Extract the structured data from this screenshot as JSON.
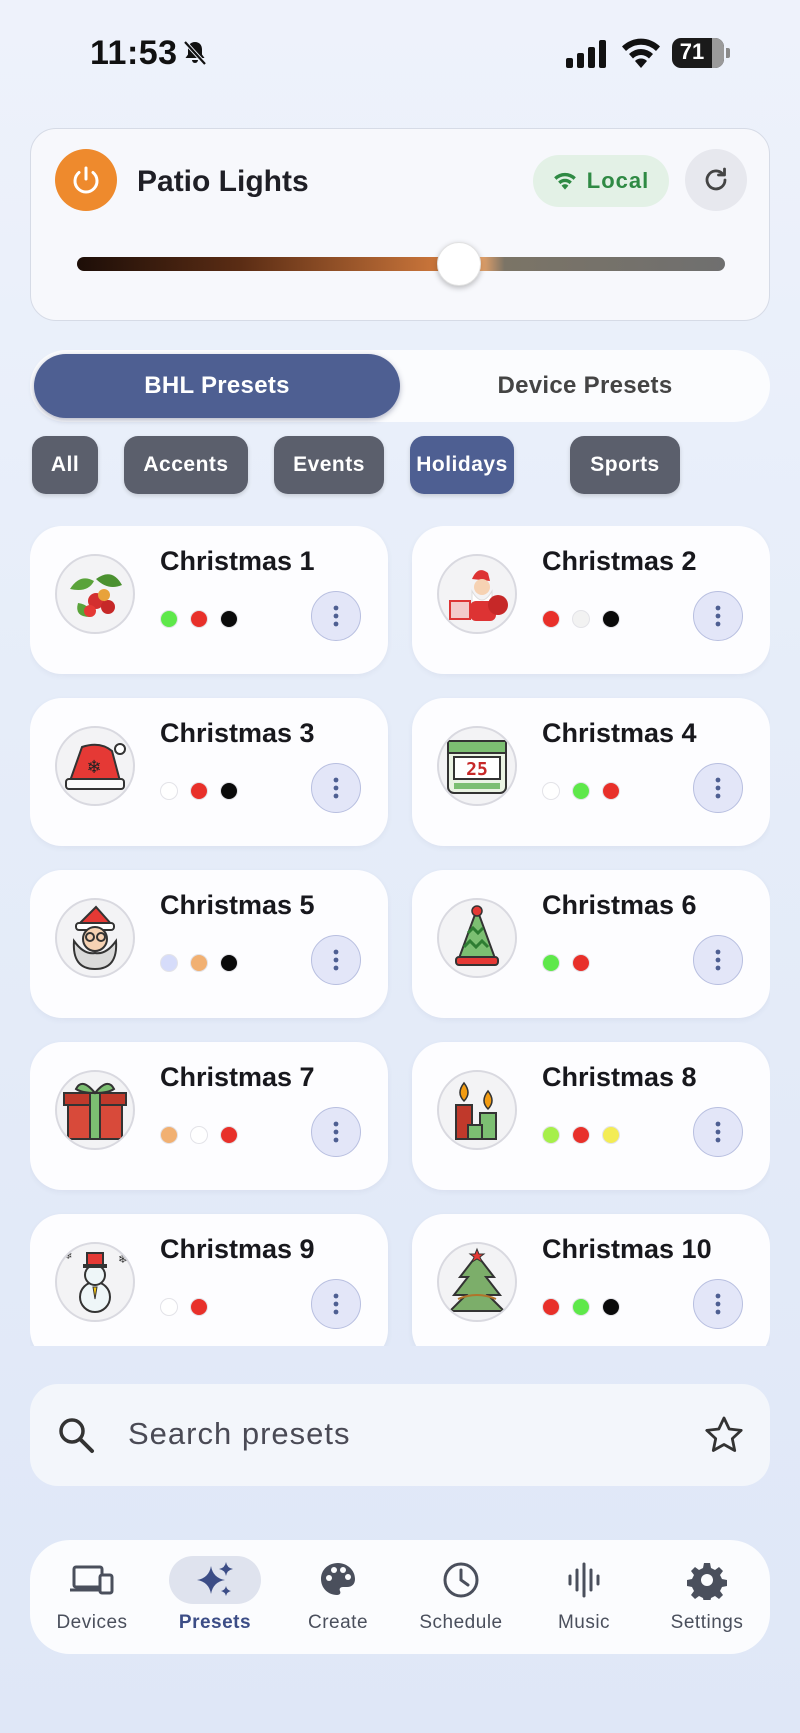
{
  "status_bar": {
    "time": "11:53",
    "battery": "71"
  },
  "device": {
    "name": "Patio Lights",
    "connection": "Local",
    "brightness_fraction": 0.59,
    "colors": {
      "power": "#ee8a2d",
      "local_text": "#2f8a44"
    }
  },
  "tabs": {
    "active": "BHL Presets",
    "inactive": "Device Presets"
  },
  "categories": [
    {
      "label": "All",
      "active": false
    },
    {
      "label": "Accents",
      "active": false
    },
    {
      "label": "Events",
      "active": false
    },
    {
      "label": "Holidays",
      "active": true
    },
    {
      "label": "Sports",
      "active": false
    }
  ],
  "presets": [
    {
      "title": "Christmas 1",
      "icon": "holly-icon",
      "colors": [
        "#5ee84a",
        "#e8302a",
        "#0a0a0a"
      ]
    },
    {
      "title": "Christmas 2",
      "icon": "santa-icon",
      "colors": [
        "#e8302a",
        "#f2f2f2",
        "#0a0a0a"
      ]
    },
    {
      "title": "Christmas 3",
      "icon": "santa-hat-icon",
      "colors": [
        "#ffffff",
        "#e8302a",
        "#0a0a0a"
      ]
    },
    {
      "title": "Christmas 4",
      "icon": "calendar-25-icon",
      "colors": [
        "#ffffff",
        "#5ee84a",
        "#e8302a"
      ]
    },
    {
      "title": "Christmas 5",
      "icon": "santa-face-icon",
      "colors": [
        "#d6dcfa",
        "#f1b072",
        "#0a0a0a"
      ]
    },
    {
      "title": "Christmas 6",
      "icon": "party-hat-icon",
      "colors": [
        "#5ee84a",
        "#e8302a"
      ]
    },
    {
      "title": "Christmas 7",
      "icon": "gift-icon",
      "colors": [
        "#f1b072",
        "#ffffff",
        "#e8302a"
      ]
    },
    {
      "title": "Christmas 8",
      "icon": "candles-icon",
      "colors": [
        "#a6ef4a",
        "#e8302a",
        "#f3ec55"
      ]
    },
    {
      "title": "Christmas 9",
      "icon": "snowman-icon",
      "colors": [
        "#ffffff",
        "#e8302a"
      ]
    },
    {
      "title": "Christmas 10",
      "icon": "christmas-tree-icon",
      "colors": [
        "#e8302a",
        "#5ee84a",
        "#0a0a0a"
      ]
    }
  ],
  "search": {
    "placeholder": "Search presets"
  },
  "nav": [
    {
      "label": "Devices",
      "icon": "devices-icon",
      "active": false
    },
    {
      "label": "Presets",
      "icon": "sparkle-icon",
      "active": true
    },
    {
      "label": "Create",
      "icon": "palette-icon",
      "active": false
    },
    {
      "label": "Schedule",
      "icon": "clock-icon",
      "active": false
    },
    {
      "label": "Music",
      "icon": "waveform-icon",
      "active": false
    },
    {
      "label": "Settings",
      "icon": "gear-icon",
      "active": false
    }
  ]
}
